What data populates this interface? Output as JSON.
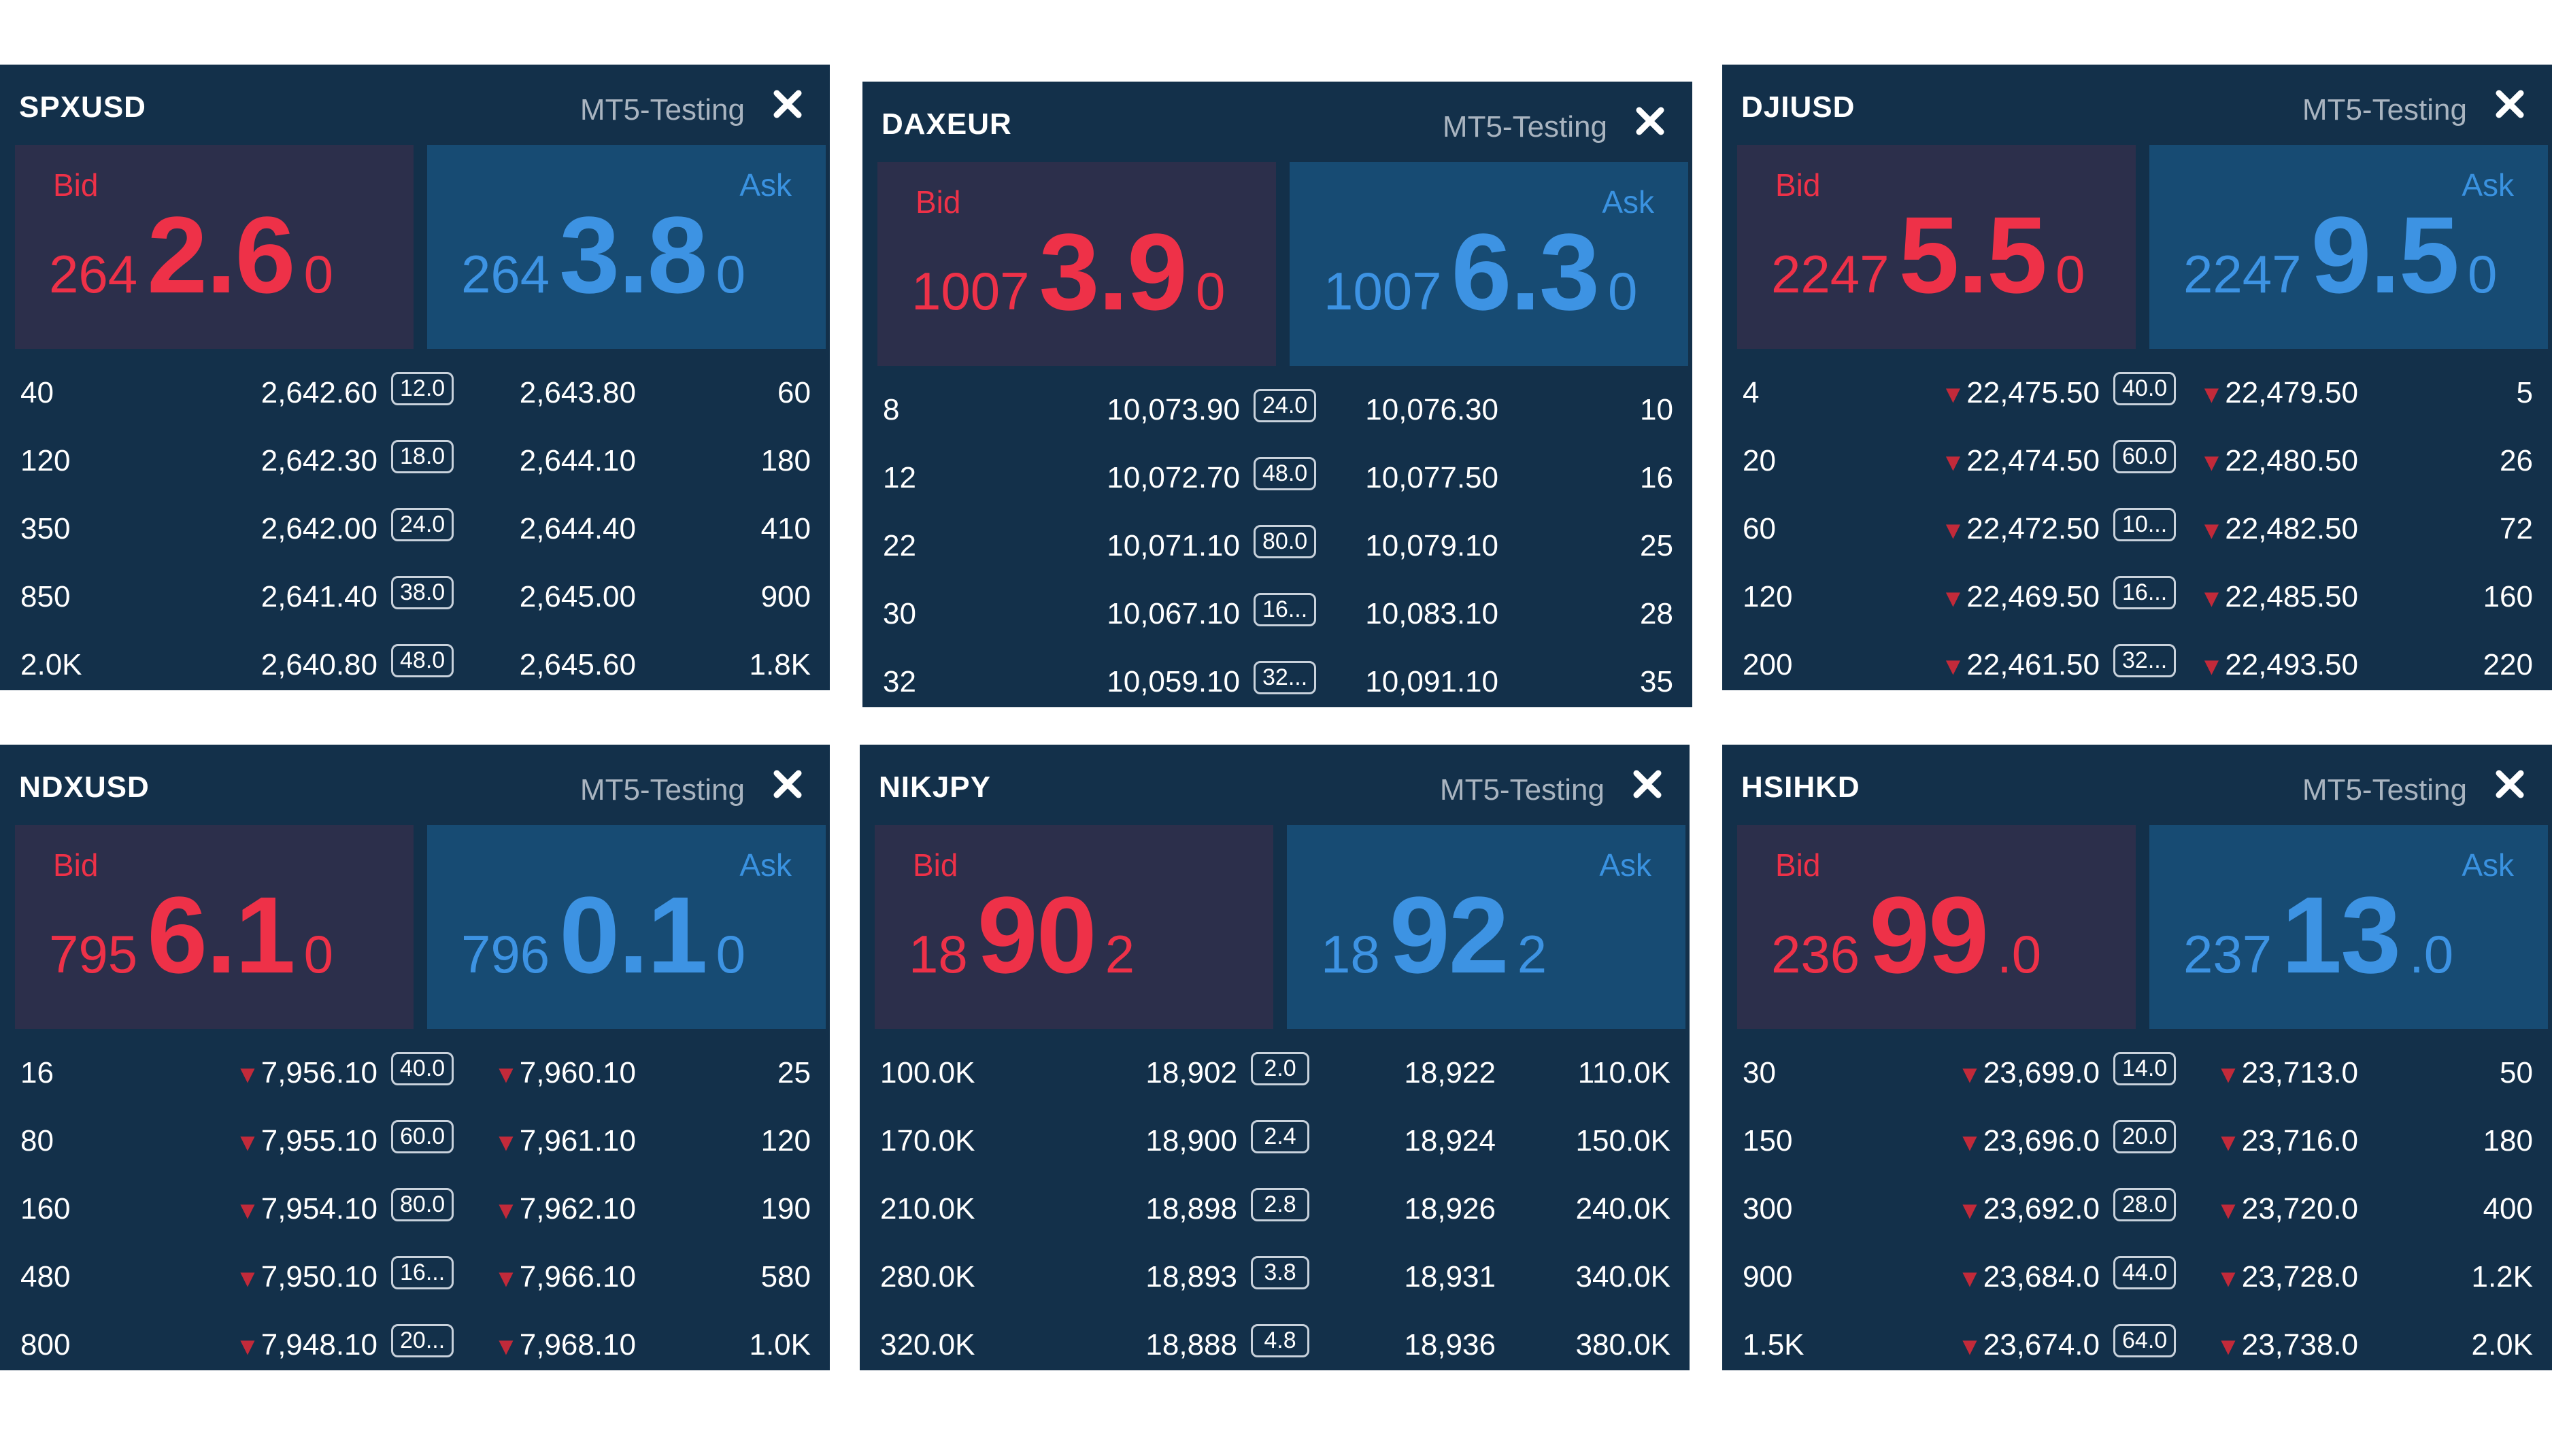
{
  "colors": {
    "bid": "#ee3148",
    "ask": "#3d93e3",
    "panel": "#13304a",
    "down_arrow": "#c22a3a"
  },
  "icons": {
    "close": "close-icon (✕)",
    "down": "down-triangle-icon"
  },
  "panels": [
    {
      "symbol": "SPXUSD",
      "server": "MT5-Testing",
      "bid": {
        "label": "Bid",
        "pre": "264",
        "big": "2.6",
        "suf": "0"
      },
      "ask": {
        "label": "Ask",
        "pre": "264",
        "big": "3.8",
        "suf": "0"
      },
      "rows": [
        {
          "vol": "40",
          "bid": "2,642.60",
          "spread": "12.0",
          "ask": "2,643.80",
          "askvol": "60",
          "down": false
        },
        {
          "vol": "120",
          "bid": "2,642.30",
          "spread": "18.0",
          "ask": "2,644.10",
          "askvol": "180",
          "down": false
        },
        {
          "vol": "350",
          "bid": "2,642.00",
          "spread": "24.0",
          "ask": "2,644.40",
          "askvol": "410",
          "down": false
        },
        {
          "vol": "850",
          "bid": "2,641.40",
          "spread": "38.0",
          "ask": "2,645.00",
          "askvol": "900",
          "down": false
        },
        {
          "vol": "2.0K",
          "bid": "2,640.80",
          "spread": "48.0",
          "ask": "2,645.60",
          "askvol": "1.8K",
          "down": false
        }
      ]
    },
    {
      "symbol": "DAXEUR",
      "server": "MT5-Testing",
      "bid": {
        "label": "Bid",
        "pre": "1007",
        "big": "3.9",
        "suf": "0"
      },
      "ask": {
        "label": "Ask",
        "pre": "1007",
        "big": "6.3",
        "suf": "0"
      },
      "rows": [
        {
          "vol": "8",
          "bid": "10,073.90",
          "spread": "24.0",
          "ask": "10,076.30",
          "askvol": "10",
          "down": false
        },
        {
          "vol": "12",
          "bid": "10,072.70",
          "spread": "48.0",
          "ask": "10,077.50",
          "askvol": "16",
          "down": false
        },
        {
          "vol": "22",
          "bid": "10,071.10",
          "spread": "80.0",
          "ask": "10,079.10",
          "askvol": "25",
          "down": false
        },
        {
          "vol": "30",
          "bid": "10,067.10",
          "spread": "16...",
          "ask": "10,083.10",
          "askvol": "28",
          "down": false
        },
        {
          "vol": "32",
          "bid": "10,059.10",
          "spread": "32...",
          "ask": "10,091.10",
          "askvol": "35",
          "down": false
        }
      ]
    },
    {
      "symbol": "DJIUSD",
      "server": "MT5-Testing",
      "bid": {
        "label": "Bid",
        "pre": "2247",
        "big": "5.5",
        "suf": "0"
      },
      "ask": {
        "label": "Ask",
        "pre": "2247",
        "big": "9.5",
        "suf": "0"
      },
      "rows": [
        {
          "vol": "4",
          "bid": "22,475.50",
          "spread": "40.0",
          "ask": "22,479.50",
          "askvol": "5",
          "down": true
        },
        {
          "vol": "20",
          "bid": "22,474.50",
          "spread": "60.0",
          "ask": "22,480.50",
          "askvol": "26",
          "down": true
        },
        {
          "vol": "60",
          "bid": "22,472.50",
          "spread": "10...",
          "ask": "22,482.50",
          "askvol": "72",
          "down": true
        },
        {
          "vol": "120",
          "bid": "22,469.50",
          "spread": "16...",
          "ask": "22,485.50",
          "askvol": "160",
          "down": true
        },
        {
          "vol": "200",
          "bid": "22,461.50",
          "spread": "32...",
          "ask": "22,493.50",
          "askvol": "220",
          "down": true
        }
      ]
    },
    {
      "symbol": "NDXUSD",
      "server": "MT5-Testing",
      "bid": {
        "label": "Bid",
        "pre": "795",
        "big": "6.1",
        "suf": "0"
      },
      "ask": {
        "label": "Ask",
        "pre": "796",
        "big": "0.1",
        "suf": "0"
      },
      "rows": [
        {
          "vol": "16",
          "bid": "7,956.10",
          "spread": "40.0",
          "ask": "7,960.10",
          "askvol": "25",
          "down": true
        },
        {
          "vol": "80",
          "bid": "7,955.10",
          "spread": "60.0",
          "ask": "7,961.10",
          "askvol": "120",
          "down": true
        },
        {
          "vol": "160",
          "bid": "7,954.10",
          "spread": "80.0",
          "ask": "7,962.10",
          "askvol": "190",
          "down": true
        },
        {
          "vol": "480",
          "bid": "7,950.10",
          "spread": "16...",
          "ask": "7,966.10",
          "askvol": "580",
          "down": true
        },
        {
          "vol": "800",
          "bid": "7,948.10",
          "spread": "20...",
          "ask": "7,968.10",
          "askvol": "1.0K",
          "down": true
        }
      ]
    },
    {
      "symbol": "NIKJPY",
      "server": "MT5-Testing",
      "bid": {
        "label": "Bid",
        "pre": "18",
        "big": "90",
        "suf": "2"
      },
      "ask": {
        "label": "Ask",
        "pre": "18",
        "big": "92",
        "suf": "2"
      },
      "rows": [
        {
          "vol": "100.0K",
          "bid": "18,902",
          "spread": "2.0",
          "ask": "18,922",
          "askvol": "110.0K",
          "down": false
        },
        {
          "vol": "170.0K",
          "bid": "18,900",
          "spread": "2.4",
          "ask": "18,924",
          "askvol": "150.0K",
          "down": false
        },
        {
          "vol": "210.0K",
          "bid": "18,898",
          "spread": "2.8",
          "ask": "18,926",
          "askvol": "240.0K",
          "down": false
        },
        {
          "vol": "280.0K",
          "bid": "18,893",
          "spread": "3.8",
          "ask": "18,931",
          "askvol": "340.0K",
          "down": false
        },
        {
          "vol": "320.0K",
          "bid": "18,888",
          "spread": "4.8",
          "ask": "18,936",
          "askvol": "380.0K",
          "down": false
        }
      ]
    },
    {
      "symbol": "HSIHKD",
      "server": "MT5-Testing",
      "bid": {
        "label": "Bid",
        "pre": "236",
        "big": "99",
        "suf": ".0"
      },
      "ask": {
        "label": "Ask",
        "pre": "237",
        "big": "13",
        "suf": ".0"
      },
      "rows": [
        {
          "vol": "30",
          "bid": "23,699.0",
          "spread": "14.0",
          "ask": "23,713.0",
          "askvol": "50",
          "down": true
        },
        {
          "vol": "150",
          "bid": "23,696.0",
          "spread": "20.0",
          "ask": "23,716.0",
          "askvol": "180",
          "down": true
        },
        {
          "vol": "300",
          "bid": "23,692.0",
          "spread": "28.0",
          "ask": "23,720.0",
          "askvol": "400",
          "down": true
        },
        {
          "vol": "900",
          "bid": "23,684.0",
          "spread": "44.0",
          "ask": "23,728.0",
          "askvol": "1.2K",
          "down": true
        },
        {
          "vol": "1.5K",
          "bid": "23,674.0",
          "spread": "64.0",
          "ask": "23,738.0",
          "askvol": "2.0K",
          "down": true
        }
      ]
    }
  ]
}
